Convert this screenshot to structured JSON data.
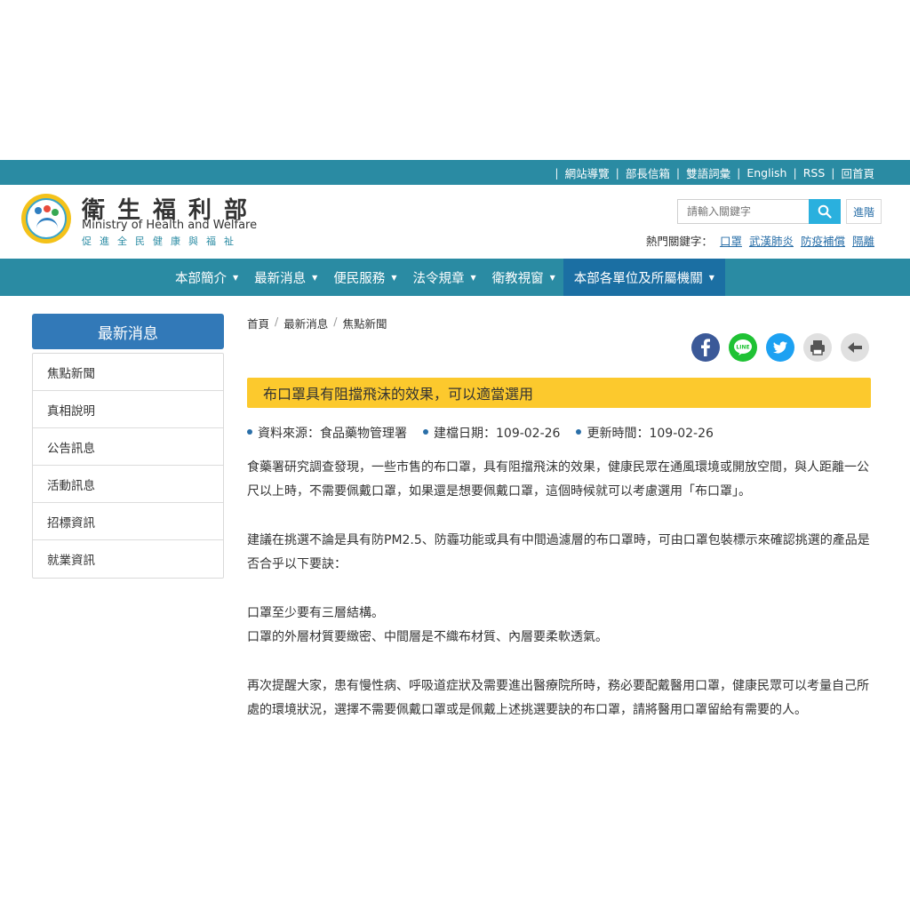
{
  "topbar": {
    "links": [
      "網站導覽",
      "部長信箱",
      "雙語詞彙",
      "English",
      "RSS",
      "回首頁"
    ]
  },
  "header": {
    "name_zh": "衛生福利部",
    "name_en": "Ministry of Health and Welfare",
    "slogan": "促進全民健康與福祉"
  },
  "search": {
    "placeholder": "請輸入關鍵字",
    "advanced_label": "進階",
    "hot_label": "熱門關鍵字：",
    "hot_keywords": [
      "口罩",
      "武漢肺炎",
      "防疫補償",
      "隔離"
    ]
  },
  "nav": {
    "items": [
      "本部簡介",
      "最新消息",
      "便民服務",
      "法令規章",
      "衛教視窗",
      "本部各單位及所屬機關"
    ]
  },
  "sidebar": {
    "title": "最新消息",
    "items": [
      "焦點新聞",
      "真相說明",
      "公告訊息",
      "活動訊息",
      "招標資訊",
      "就業資訊"
    ]
  },
  "breadcrumb": [
    "首頁",
    "最新消息",
    "焦點新聞"
  ],
  "colors": {
    "brand": "#2a8ba3",
    "nav_active": "#1b6fa3",
    "sidebar_title": "#3279b8",
    "title_bar": "#fcc92d"
  },
  "share_icons": [
    "facebook-icon",
    "line-icon",
    "twitter-icon",
    "print-icon",
    "back-icon"
  ],
  "article": {
    "title": "布口罩具有阻擋飛沫的效果，可以適當選用",
    "source": "資料來源：食品藥物管理署",
    "created": "建檔日期：109-02-26",
    "updated": "更新時間：109-02-26",
    "p1": "食藥署研究調查發現，一些市售的布口罩，具有阻擋飛沫的效果，健康民眾在通風環境或開放空間，與人距離一公尺以上時，不需要佩戴口罩，如果還是想要佩戴口罩，這個時候就可以考慮選用「布口罩」。",
    "p2": "建議在挑選不論是具有防PM2.5、防霾功能或具有中間過濾層的布口罩時，可由口罩包裝標示來確認挑選的產品是否合乎以下要訣：",
    "p3a": "口罩至少要有三層結構。",
    "p3b": "口罩的外層材質要緻密、中間層是不織布材質、內層要柔軟透氣。",
    "p4": "再次提醒大家，患有慢性病、呼吸道症狀及需要進出醫療院所時，務必要配戴醫用口罩，健康民眾可以考量自己所處的環境狀況，選擇不需要佩戴口罩或是佩戴上述挑選要訣的布口罩，請將醫用口罩留給有需要的人。"
  }
}
